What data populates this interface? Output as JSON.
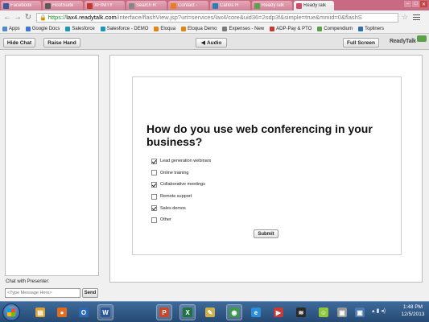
{
  "browser": {
    "tabs": [
      {
        "label": "Facebook",
        "color": "#3b5998",
        "active": false
      },
      {
        "label": "HootSuite",
        "color": "#5a5a5a",
        "active": false
      },
      {
        "label": "XFINITY",
        "color": "#c0392b",
        "active": false
      },
      {
        "label": "Search R",
        "color": "#888888",
        "active": false
      },
      {
        "label": "Contact -",
        "color": "#e67e22",
        "active": false
      },
      {
        "label": "Carlos H",
        "color": "#2980b9",
        "active": false
      },
      {
        "label": "ReadyTalk",
        "color": "#5aa14a",
        "active": false
      },
      {
        "label": "ReadyTalk",
        "color": "#d04a6a",
        "active": true
      }
    ],
    "url": {
      "scheme": "https://",
      "host": "lax4.readytalk.com",
      "rest": "/interface/flashView.jsp?uri=services/lax4/core&uid36=2sdp3f&simple=true&mmid=0&flashS"
    },
    "bookmarks": [
      {
        "label": "Apps",
        "color": "#4a8ad4"
      },
      {
        "label": "Google Docs",
        "color": "#3c78d8"
      },
      {
        "label": "Salesforce",
        "color": "#1798c1"
      },
      {
        "label": "Salesforce - DEMO",
        "color": "#1798c1"
      },
      {
        "label": "Eloqua",
        "color": "#e8830f"
      },
      {
        "label": "Eloqua Demo",
        "color": "#e8830f"
      },
      {
        "label": "Expenses - New",
        "color": "#7a7a7a"
      },
      {
        "label": "ADP-Pay & PTO",
        "color": "#d0352c"
      },
      {
        "label": "Compendium",
        "color": "#5aa14a"
      },
      {
        "label": "Topliners",
        "color": "#2a6db8"
      }
    ]
  },
  "toolbar": {
    "hide_chat": "Hide Chat",
    "raise_hand": "Raise Hand",
    "audio": "Audio",
    "full_screen": "Full Screen",
    "logo": "ReadyTalk"
  },
  "chat": {
    "label": "Chat with Presenter:",
    "placeholder": "<Type Message Here>",
    "send": "Send"
  },
  "poll": {
    "question": "How do you use web conferencing in your business?",
    "options": [
      {
        "label": "Lead generation webinars",
        "checked": true
      },
      {
        "label": "Online training",
        "checked": false
      },
      {
        "label": "Collaborative meetings",
        "checked": true
      },
      {
        "label": "Remote support",
        "checked": false
      },
      {
        "label": "Sales demos",
        "checked": true
      },
      {
        "label": "Other",
        "checked": false
      }
    ],
    "submit": "Submit"
  },
  "taskbar": {
    "apps": [
      {
        "name": "explorer",
        "color": "#d9a23a",
        "glyph": "▤"
      },
      {
        "name": "firefox",
        "color": "#e06c1f",
        "glyph": "●"
      },
      {
        "name": "outlook",
        "color": "#2a67b5",
        "glyph": "O"
      },
      {
        "name": "word",
        "color": "#2b579a",
        "glyph": "W"
      },
      {
        "name": "powerpoint",
        "color": "#c8472b",
        "glyph": "P"
      },
      {
        "name": "excel",
        "color": "#217346",
        "glyph": "X"
      },
      {
        "name": "paint",
        "color": "#d0b04a",
        "glyph": "✎"
      },
      {
        "name": "chrome",
        "color": "#3d9b47",
        "glyph": "◉"
      },
      {
        "name": "internet-explorer",
        "color": "#2b8ed6",
        "glyph": "e"
      },
      {
        "name": "media",
        "color": "#c43b3b",
        "glyph": "▶"
      },
      {
        "name": "spotify",
        "color": "#2a2a2a",
        "glyph": "≋"
      },
      {
        "name": "messenger",
        "color": "#8fc73e",
        "glyph": "☺"
      },
      {
        "name": "app-13",
        "color": "#9a9a9a",
        "glyph": "▣"
      },
      {
        "name": "app-14",
        "color": "#4c7ab2",
        "glyph": "▣"
      }
    ],
    "time": "1:48 PM",
    "date": "12/5/2013"
  }
}
